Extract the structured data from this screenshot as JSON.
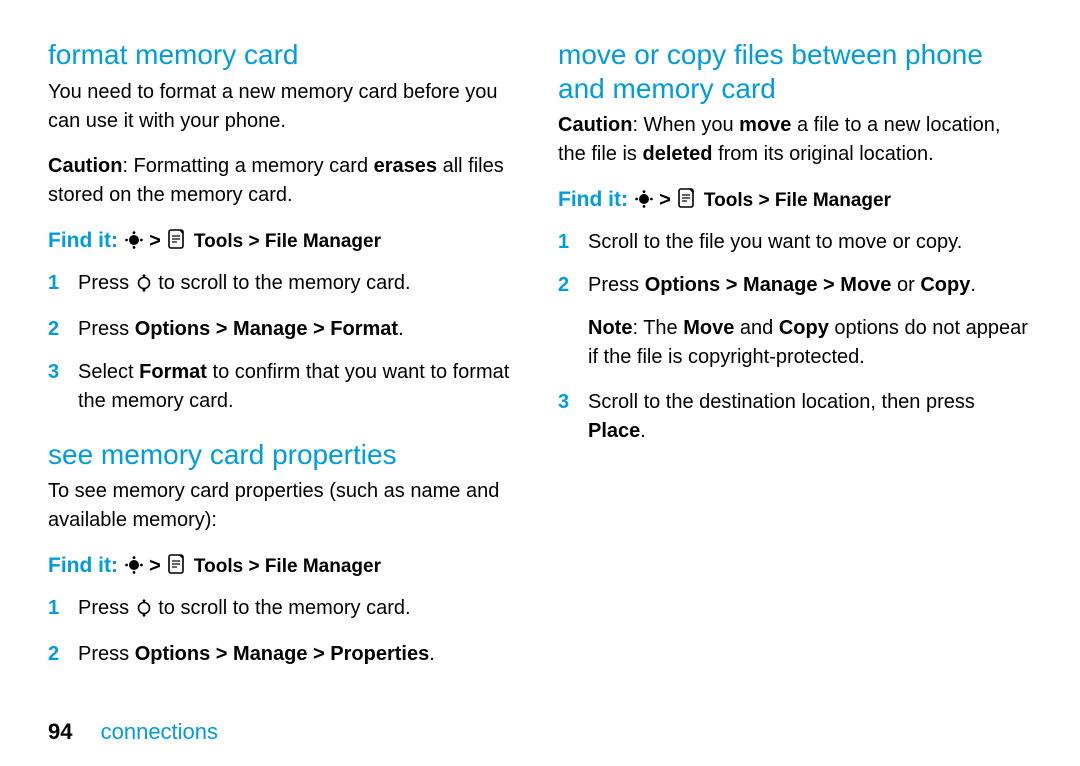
{
  "left": {
    "section1": {
      "title": "format memory card",
      "intro": "You need to format a new memory card before you can use it with your phone.",
      "caution_label": "Caution",
      "caution_before": ": Formatting a memory card ",
      "caution_bold": "erases",
      "caution_after": " all files stored on the memory card.",
      "findit_label": "Find it:",
      "findit_path": "Tools > File Manager",
      "steps": {
        "s1_a": "Press ",
        "s1_b": " to scroll to the memory card.",
        "s2_a": "Press ",
        "s2_b": "Options > Manage > Format",
        "s2_c": ".",
        "s3_a": "Select ",
        "s3_b": "Format",
        "s3_c": " to confirm that you want to format the memory card."
      }
    },
    "section2": {
      "title": "see memory card properties",
      "intro": "To see memory card properties (such as name and available memory):",
      "findit_label": "Find it:",
      "findit_path": "Tools > File Manager",
      "steps": {
        "s1_a": "Press ",
        "s1_b": " to scroll to the memory card.",
        "s2_a": "Press ",
        "s2_b": "Options > Manage > Properties",
        "s2_c": "."
      }
    }
  },
  "right": {
    "section1": {
      "title": "move or copy files between phone and memory card",
      "caution_label": "Caution",
      "caution_a": ": When you ",
      "caution_b": "move",
      "caution_c": " a file to a new location, the file is ",
      "caution_d": "deleted",
      "caution_e": " from its original location.",
      "findit_label": "Find it:",
      "findit_path": "Tools > File Manager",
      "steps": {
        "s1": "Scroll to the file you want to move or copy.",
        "s2_a": "Press ",
        "s2_b": "Options > Manage > Move",
        "s2_c": " or ",
        "s2_d": "Copy",
        "s2_e": ".",
        "note_label": "Note",
        "note_a": ": The ",
        "note_b": "Move",
        "note_c": " and ",
        "note_d": "Copy",
        "note_e": " options do not appear if the file is copyright-protected.",
        "s3_a": "Scroll to the destination location, then press ",
        "s3_b": "Place",
        "s3_c": "."
      }
    }
  },
  "footer": {
    "page_number": "94",
    "chapter": "connections"
  },
  "symbols": {
    "gt": ">"
  }
}
